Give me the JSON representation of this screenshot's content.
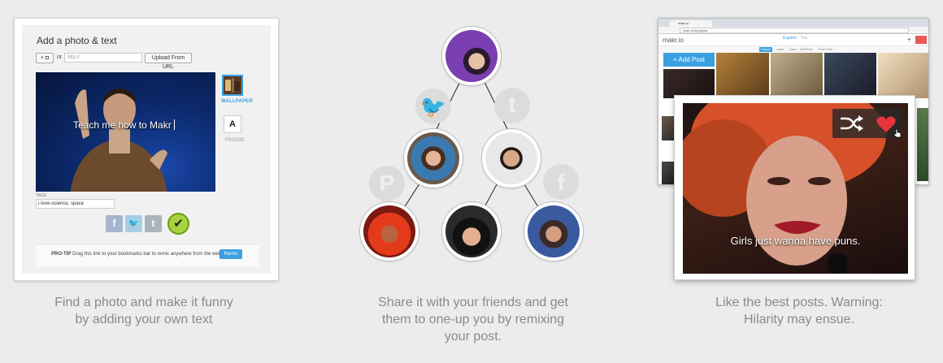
{
  "panel_editor": {
    "title": "Add a photo & text",
    "camera_button": "+ ◘",
    "or_label": "or",
    "url_placeholder": "http://",
    "upload_button": "Upload From URL",
    "photo_caption": "Teach me how to Makr",
    "styles": [
      {
        "label": "WALLPAPER",
        "selected": true
      },
      {
        "label": "FRIDGE",
        "selected": false
      }
    ],
    "tags_label": "TAGS",
    "tags_value": "i-love-science, space",
    "share_icons": [
      "facebook-icon",
      "twitter-icon",
      "tumblr-icon",
      "checkmark-icon"
    ],
    "tip_bold": "PRO-TIP",
    "tip_text": " Drag this link to your bookmarks bar to remix anywhere from the web →",
    "remix_button": "Remix",
    "caption_line1": "Find a photo and make it funny",
    "caption_line2": "by adding your own text"
  },
  "panel_share": {
    "icons": [
      "twitter-icon",
      "tumblr-icon",
      "pinterest-icon",
      "facebook-icon"
    ],
    "caption_line1": "Share it with your friends and get",
    "caption_line2": "them to one-up you by remixing",
    "caption_line3": "your post."
  },
  "panel_like": {
    "browser_tab": "makr.io",
    "browser_url": "makr.io/#/popular",
    "logo": "makr.io",
    "nav_explore": "Explore",
    "nav_you": "You",
    "sub_tabs": [
      "Popular",
      "Latest",
      "Topics",
      "StaffPicks",
      "Trivia Posts"
    ],
    "add_post": "+ Add Post",
    "feature_caption": "Girls just wanna have puns.",
    "caption_line1": "Like the best posts. Warning:",
    "caption_line2": "Hilarity may ensue."
  },
  "colors": {
    "accent": "#3aa0e0",
    "heart": "#e8323c",
    "check_green": "#a7d23c",
    "caption_gray": "#8a8a8a"
  }
}
